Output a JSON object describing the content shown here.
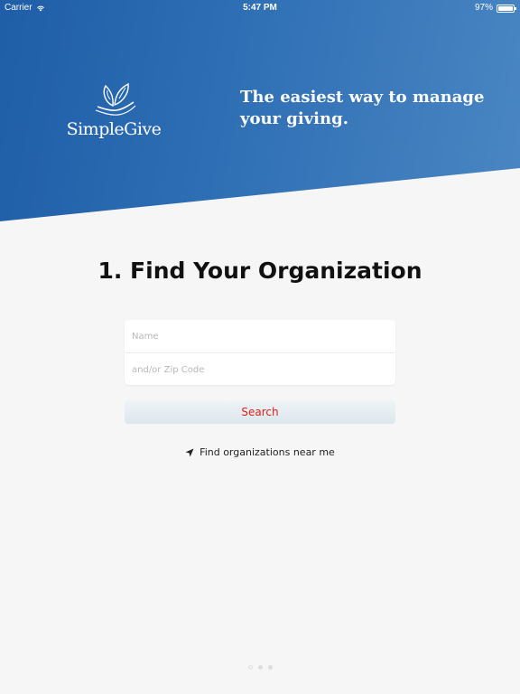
{
  "statusbar": {
    "carrier": "Carrier",
    "time": "5:47 PM",
    "battery": "97%",
    "battery_level": 0.97,
    "icons": {
      "wifi": "wifi-icon",
      "battery": "battery-icon"
    }
  },
  "brand": {
    "name": "SimpleGive",
    "tagline": "The easiest way to manage your giving.",
    "logo_icon": "hand-with-leaf-icon"
  },
  "form": {
    "heading": "1. Find Your Organization",
    "name_placeholder": "Name",
    "zip_placeholder": "and/or Zip Code",
    "search_label": "Search",
    "nearby_label": "Find organizations near me",
    "nearby_icon": "location-arrow-icon"
  },
  "pagination": {
    "pages": 3,
    "active": 1
  },
  "colors": {
    "brand_blue": "#2f6fb4",
    "search_text": "#e11c1c",
    "background": "#f6f6f6"
  }
}
